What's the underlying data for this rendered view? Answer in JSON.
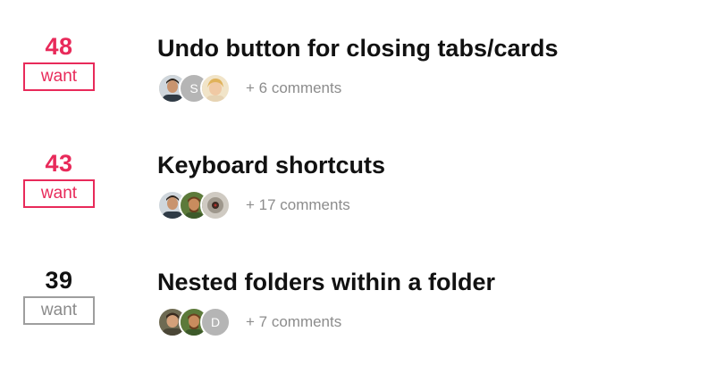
{
  "requests": [
    {
      "votes": "48",
      "want_label": "want",
      "state": "active",
      "title": "Undo button for closing tabs/cards",
      "comments": "+ 6 comments",
      "avatars": [
        {
          "kind": "photo",
          "name": "user-photo-1"
        },
        {
          "kind": "initial",
          "letter": "S",
          "color": "#b5b5b5"
        },
        {
          "kind": "photo",
          "name": "user-photo-2"
        }
      ]
    },
    {
      "votes": "43",
      "want_label": "want",
      "state": "active",
      "title": "Keyboard shortcuts",
      "comments": "+ 17 comments",
      "avatars": [
        {
          "kind": "photo",
          "name": "user-photo-1"
        },
        {
          "kind": "photo",
          "name": "user-photo-3"
        },
        {
          "kind": "photo",
          "name": "user-photo-4"
        }
      ]
    },
    {
      "votes": "39",
      "want_label": "want",
      "state": "inactive",
      "title": "Nested folders within a folder",
      "comments": "+ 7 comments",
      "avatars": [
        {
          "kind": "photo",
          "name": "user-photo-5"
        },
        {
          "kind": "photo",
          "name": "user-photo-3"
        },
        {
          "kind": "initial",
          "letter": "D",
          "color": "#b5b5b5"
        }
      ]
    }
  ],
  "colors": {
    "active": "#e82a5a",
    "inactive_border": "#9e9e9e",
    "text": "#111111",
    "muted": "#8c8c8c"
  }
}
